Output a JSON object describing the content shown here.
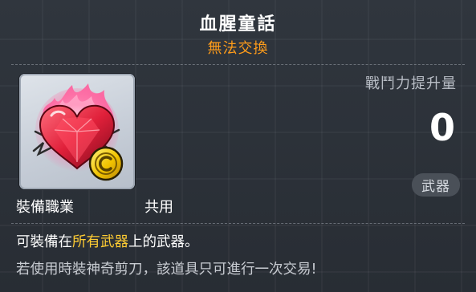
{
  "item": {
    "name": "血腥童話",
    "trade_status": "無法交換",
    "icon": "bloody-heart-gem-icon",
    "coin_badge_icon": "gold-coin-icon"
  },
  "stats": {
    "power_label": "戰鬥力提升量",
    "power_value": "0",
    "category": "武器"
  },
  "requirements": {
    "job_label": "裝備職業",
    "job_value": "共用"
  },
  "description": {
    "line1_before": "可裝備在",
    "line1_highlight": "所有武器",
    "line1_after": "上的武器。",
    "line2": "若使用時裝神奇剪刀，該道具只可進行一次交易!"
  },
  "colors": {
    "title": "#ffffff",
    "trade_status": "#ff9c1a",
    "highlight": "#ffcc33"
  }
}
